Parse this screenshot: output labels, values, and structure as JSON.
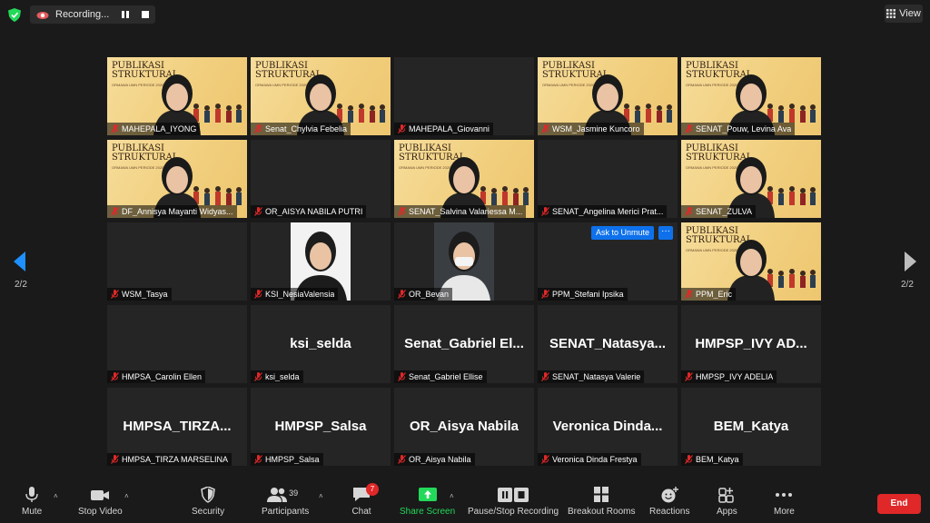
{
  "recording": {
    "label": "Recording..."
  },
  "view_button": {
    "label": "View"
  },
  "pagination": {
    "left": "2/2",
    "right": "2/2"
  },
  "slide": {
    "title": "PUBLIKASI STRUKTURAL",
    "subtitle": "ORMAWA UMN PERIODE 2020/2021"
  },
  "participants": [
    {
      "name": "MAHEPALA_IYONG",
      "type": "slide-face"
    },
    {
      "name": "Senat_Chylvia Febelia",
      "type": "slide-face"
    },
    {
      "name": "MAHEPALA_Giovanni",
      "type": "blank"
    },
    {
      "name": "WSM_Jasmine Kuncoro",
      "type": "slide-face"
    },
    {
      "name": "SENAT_Pouw, Levina Ava",
      "type": "slide-face"
    },
    {
      "name": "DF_Annisya Mayanti Widyas...",
      "type": "slide-face"
    },
    {
      "name": "OR_AISYA NABILA PUTRI",
      "type": "blank"
    },
    {
      "name": "SENAT_Salvina Valariessa M...",
      "type": "slide-face"
    },
    {
      "name": "SENAT_Angelina Merici Prat...",
      "type": "blank"
    },
    {
      "name": "SENAT_ZULVA",
      "type": "slide-face"
    },
    {
      "name": "WSM_Tasya",
      "type": "blank"
    },
    {
      "name": "KSI_NesiaValensia",
      "type": "photo"
    },
    {
      "name": "OR_Bevan",
      "type": "photo"
    },
    {
      "name": "PPM_Stefani Ipsika",
      "type": "blank",
      "ask_unmute": "Ask to Unmute",
      "more": "···"
    },
    {
      "name": "PPM_Eric",
      "type": "slide-face"
    },
    {
      "name": "HMPSA_Carolin Ellen",
      "type": "blank"
    },
    {
      "name": "ksi_selda",
      "type": "text",
      "big": "ksi_selda"
    },
    {
      "name": "Senat_Gabriel Ellise",
      "type": "text",
      "big": "Senat_Gabriel El..."
    },
    {
      "name": "SENAT_Natasya Valerie",
      "type": "text",
      "big": "SENAT_Natasya..."
    },
    {
      "name": "HMPSP_IVY ADELIA",
      "type": "text",
      "big": "HMPSP_IVY AD..."
    },
    {
      "name": "HMPSA_TIRZA MARSELINA",
      "type": "text",
      "big": "HMPSA_TIRZA..."
    },
    {
      "name": "HMPSP_Salsa",
      "type": "text",
      "big": "HMPSP_Salsa"
    },
    {
      "name": "OR_Aisya Nabila",
      "type": "text",
      "big": "OR_Aisya Nabila"
    },
    {
      "name": "Veronica Dinda Frestya",
      "type": "text",
      "big": "Veronica Dinda..."
    },
    {
      "name": "BEM_Katya",
      "type": "text",
      "big": "BEM_Katya"
    }
  ],
  "toolbar": {
    "mute": "Mute",
    "stop_video": "Stop Video",
    "security": "Security",
    "participants": "Participants",
    "participants_count": "39",
    "chat": "Chat",
    "chat_badge": "7",
    "share_screen": "Share Screen",
    "pause_recording": "Pause/Stop Recording",
    "breakout_rooms": "Breakout Rooms",
    "reactions": "Reactions",
    "apps": "Apps",
    "more": "More",
    "end": "End",
    "caret": "˄"
  },
  "colors": {
    "share_green": "#23d959",
    "end_red": "#e02828",
    "accent_blue": "#0e71eb",
    "muted_red": "#e02828"
  }
}
